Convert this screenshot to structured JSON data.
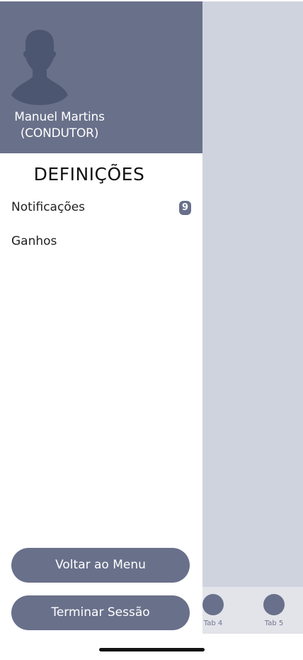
{
  "drawer": {
    "user": {
      "name": "Manuel Martins",
      "role": "(CONDUTOR)"
    },
    "section_title": "DEFINIÇÕES",
    "items": [
      {
        "label": "Notificações",
        "badge": "9"
      },
      {
        "label": "Ganhos"
      }
    ],
    "buttons": {
      "back": "Voltar ao Menu",
      "logout": "Terminar Sessão"
    }
  },
  "tabbar": {
    "tabs": [
      {
        "label": "Tab 4"
      },
      {
        "label": "Tab 5"
      }
    ]
  },
  "colors": {
    "primary": "#69708a",
    "background_app": "#cfd3de",
    "tabbar": "#e3e4e9"
  }
}
